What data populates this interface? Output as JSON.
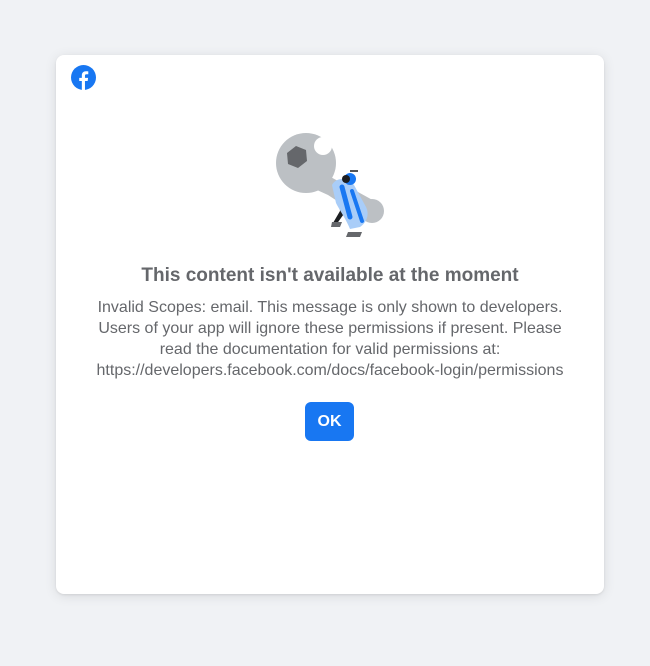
{
  "dialog": {
    "logo_icon": "facebook-logo-icon",
    "illustration_icon": "wrench-repair-illustration-icon",
    "title": "This content isn't available at the moment",
    "message_lines": [
      "Invalid Scopes: email. This message is only shown to developers.",
      "Users of your app will ignore these permissions if present. Please",
      "read the documentation for valid permissions at:",
      "https://developers.facebook.com/docs/facebook-login/permissions"
    ],
    "ok_label": "OK"
  },
  "colors": {
    "page_background": "#f0f2f5",
    "card_background": "#ffffff",
    "accent": "#1877f2",
    "text_secondary": "#65676b"
  }
}
